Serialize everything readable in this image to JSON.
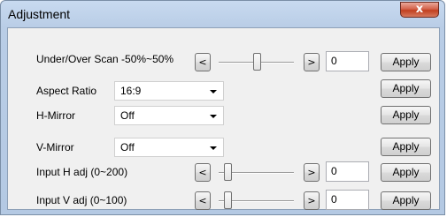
{
  "window": {
    "title": "Adjustment",
    "close_glyph": "x"
  },
  "apply_label": "Apply",
  "arrows": {
    "left": "<",
    "right": ">"
  },
  "rows": {
    "scan": {
      "label": "Under/Over Scan -50%~50%",
      "value": "0",
      "slider_fraction": 0.5
    },
    "aspect": {
      "label": "Aspect Ratio",
      "selected": "16:9"
    },
    "hmirror": {
      "label": "H-Mirror",
      "selected": "Off"
    },
    "vmirror": {
      "label": "V-Mirror",
      "selected": "Off"
    },
    "inputh": {
      "label": "Input H adj (0~200)",
      "value": "0",
      "slider_fraction": 0.0
    },
    "inputv": {
      "label": "Input V adj (0~100)",
      "value": "0",
      "slider_fraction": 0.0
    }
  }
}
